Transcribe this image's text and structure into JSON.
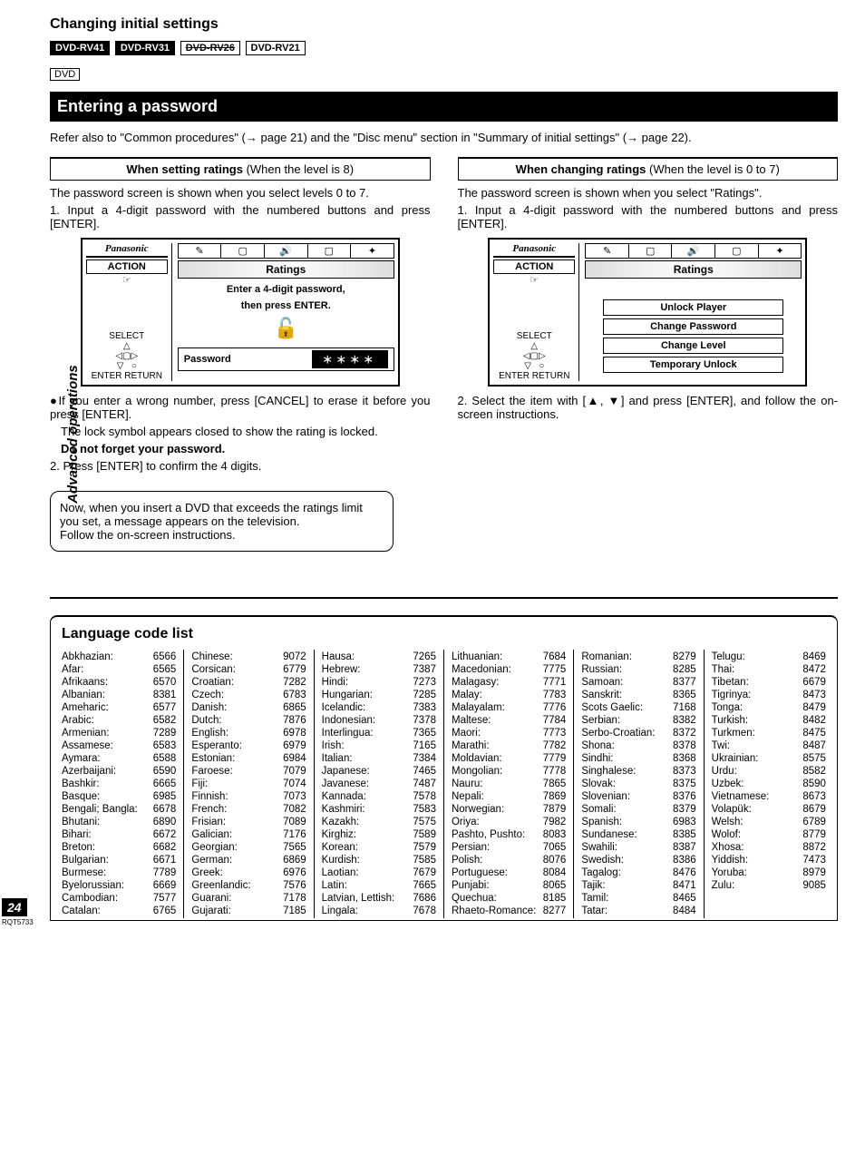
{
  "side_label": "Advanced operations",
  "page_title": "Changing initial settings",
  "models": {
    "rv41": "DVD-RV41",
    "rv31": "DVD-RV31",
    "rv26": "DVD-RV26",
    "rv21": "DVD-RV21",
    "dvd": "DVD"
  },
  "section_title": "Entering a password",
  "refer": "Refer also to \"Common procedures\" (→ page 21) and the \"Disc menu\" section in \"Summary of initial settings\" (→ page 22).",
  "left": {
    "head_bold": "When setting ratings",
    "head_rest": " (When the level is 8)",
    "intro": "The password screen is shown when you select levels 0 to 7.",
    "step1": "1. Input a 4-digit password with the numbered buttons and press [ENTER].",
    "bullet": "●If you enter a wrong number, press [CANCEL] to erase it before you press [ENTER].",
    "locknote": "The lock symbol appears closed to show the rating is locked.",
    "dontforget": "Do not forget your password.",
    "step2": "2. Press [ENTER] to confirm the 4 digits."
  },
  "right": {
    "head_bold": "When changing ratings",
    "head_rest": " (When the level is 0 to 7)",
    "intro": "The password screen is shown when you select \"Ratings\".",
    "step1": "1. Input a 4-digit password with the numbered buttons and press [ENTER].",
    "step2": "2. Select the item with [▲, ▼] and press [ENTER], and follow the on-screen instructions."
  },
  "screen": {
    "brand": "Panasonic",
    "action": "ACTION",
    "select": "SELECT",
    "enter_return": "ENTER RETURN",
    "ratings": "Ratings",
    "prompt1": "Enter a 4-digit password,",
    "prompt2": "then press ENTER.",
    "pw_label": "Password",
    "pw_stars": "＊＊＊＊",
    "opts": {
      "unlock": "Unlock Player",
      "change_pw": "Change Password",
      "change_lv": "Change Level",
      "temp": "Temporary Unlock"
    }
  },
  "notebox": "Now, when you insert a DVD that exceeds the ratings limit you set, a message appears on the television.\nFollow the on-screen instructions.",
  "lang_title": "Language code list",
  "langs": [
    [
      [
        "Abkhazian:",
        "6566"
      ],
      [
        "Afar:",
        "6565"
      ],
      [
        "Afrikaans:",
        "6570"
      ],
      [
        "Albanian:",
        "8381"
      ],
      [
        "Ameharic:",
        "6577"
      ],
      [
        "Arabic:",
        "6582"
      ],
      [
        "Armenian:",
        "7289"
      ],
      [
        "Assamese:",
        "6583"
      ],
      [
        "Aymara:",
        "6588"
      ],
      [
        "Azerbaijani:",
        "6590"
      ],
      [
        "Bashkir:",
        "6665"
      ],
      [
        "Basque:",
        "6985"
      ],
      [
        "Bengali; Bangla:",
        "6678"
      ],
      [
        "Bhutani:",
        "6890"
      ],
      [
        "Bihari:",
        "6672"
      ],
      [
        "Breton:",
        "6682"
      ],
      [
        "Bulgarian:",
        "6671"
      ],
      [
        "Burmese:",
        "7789"
      ],
      [
        "Byelorussian:",
        "6669"
      ],
      [
        "Cambodian:",
        "7577"
      ],
      [
        "Catalan:",
        "6765"
      ]
    ],
    [
      [
        "Chinese:",
        "9072"
      ],
      [
        "Corsican:",
        "6779"
      ],
      [
        "Croatian:",
        "7282"
      ],
      [
        "Czech:",
        "6783"
      ],
      [
        "Danish:",
        "6865"
      ],
      [
        "Dutch:",
        "7876"
      ],
      [
        "English:",
        "6978"
      ],
      [
        "Esperanto:",
        "6979"
      ],
      [
        "Estonian:",
        "6984"
      ],
      [
        "Faroese:",
        "7079"
      ],
      [
        "Fiji:",
        "7074"
      ],
      [
        "Finnish:",
        "7073"
      ],
      [
        "French:",
        "7082"
      ],
      [
        "Frisian:",
        "7089"
      ],
      [
        "Galician:",
        "7176"
      ],
      [
        "Georgian:",
        "7565"
      ],
      [
        "German:",
        "6869"
      ],
      [
        "Greek:",
        "6976"
      ],
      [
        "Greenlandic:",
        "7576"
      ],
      [
        "Guarani:",
        "7178"
      ],
      [
        "Gujarati:",
        "7185"
      ]
    ],
    [
      [
        "Hausa:",
        "7265"
      ],
      [
        "Hebrew:",
        "7387"
      ],
      [
        "Hindi:",
        "7273"
      ],
      [
        "Hungarian:",
        "7285"
      ],
      [
        "Icelandic:",
        "7383"
      ],
      [
        "Indonesian:",
        "7378"
      ],
      [
        "Interlingua:",
        "7365"
      ],
      [
        "Irish:",
        "7165"
      ],
      [
        "Italian:",
        "7384"
      ],
      [
        "Japanese:",
        "7465"
      ],
      [
        "Javanese:",
        "7487"
      ],
      [
        "Kannada:",
        "7578"
      ],
      [
        "Kashmiri:",
        "7583"
      ],
      [
        "Kazakh:",
        "7575"
      ],
      [
        "Kirghiz:",
        "7589"
      ],
      [
        "Korean:",
        "7579"
      ],
      [
        "Kurdish:",
        "7585"
      ],
      [
        "Laotian:",
        "7679"
      ],
      [
        "Latin:",
        "7665"
      ],
      [
        "Latvian, Lettish:",
        "7686"
      ],
      [
        "Lingala:",
        "7678"
      ]
    ],
    [
      [
        "Lithuanian:",
        "7684"
      ],
      [
        "Macedonian:",
        "7775"
      ],
      [
        "Malagasy:",
        "7771"
      ],
      [
        "Malay:",
        "7783"
      ],
      [
        "Malayalam:",
        "7776"
      ],
      [
        "Maltese:",
        "7784"
      ],
      [
        "Maori:",
        "7773"
      ],
      [
        "Marathi:",
        "7782"
      ],
      [
        "Moldavian:",
        "7779"
      ],
      [
        "Mongolian:",
        "7778"
      ],
      [
        "Nauru:",
        "7865"
      ],
      [
        "Nepali:",
        "7869"
      ],
      [
        "Norwegian:",
        "7879"
      ],
      [
        "Oriya:",
        "7982"
      ],
      [
        "Pashto, Pushto:",
        "8083"
      ],
      [
        "Persian:",
        "7065"
      ],
      [
        "Polish:",
        "8076"
      ],
      [
        "Portuguese:",
        "8084"
      ],
      [
        "Punjabi:",
        "8065"
      ],
      [
        "Quechua:",
        "8185"
      ],
      [
        "Rhaeto-Romance:",
        "8277"
      ]
    ],
    [
      [
        "Romanian:",
        "8279"
      ],
      [
        "Russian:",
        "8285"
      ],
      [
        "Samoan:",
        "8377"
      ],
      [
        "Sanskrit:",
        "8365"
      ],
      [
        "Scots Gaelic:",
        "7168"
      ],
      [
        "Serbian:",
        "8382"
      ],
      [
        "Serbo-Croatian:",
        "8372"
      ],
      [
        "Shona:",
        "8378"
      ],
      [
        "Sindhi:",
        "8368"
      ],
      [
        "Singhalese:",
        "8373"
      ],
      [
        "Slovak:",
        "8375"
      ],
      [
        "Slovenian:",
        "8376"
      ],
      [
        "Somali:",
        "8379"
      ],
      [
        "Spanish:",
        "6983"
      ],
      [
        "Sundanese:",
        "8385"
      ],
      [
        "Swahili:",
        "8387"
      ],
      [
        "Swedish:",
        "8386"
      ],
      [
        "Tagalog:",
        "8476"
      ],
      [
        "Tajik:",
        "8471"
      ],
      [
        "Tamil:",
        "8465"
      ],
      [
        "Tatar:",
        "8484"
      ]
    ],
    [
      [
        "Telugu:",
        "8469"
      ],
      [
        "Thai:",
        "8472"
      ],
      [
        "Tibetan:",
        "6679"
      ],
      [
        "Tigrinya:",
        "8473"
      ],
      [
        "Tonga:",
        "8479"
      ],
      [
        "Turkish:",
        "8482"
      ],
      [
        "Turkmen:",
        "8475"
      ],
      [
        "Twi:",
        "8487"
      ],
      [
        "Ukrainian:",
        "8575"
      ],
      [
        "Urdu:",
        "8582"
      ],
      [
        "Uzbek:",
        "8590"
      ],
      [
        "Vietnamese:",
        "8673"
      ],
      [
        "Volapük:",
        "8679"
      ],
      [
        "Welsh:",
        "6789"
      ],
      [
        "Wolof:",
        "8779"
      ],
      [
        "Xhosa:",
        "8872"
      ],
      [
        "Yiddish:",
        "7473"
      ],
      [
        "Yoruba:",
        "8979"
      ],
      [
        "Zulu:",
        "9085"
      ]
    ]
  ],
  "page_num": "24",
  "doc_code": "RQT5733"
}
